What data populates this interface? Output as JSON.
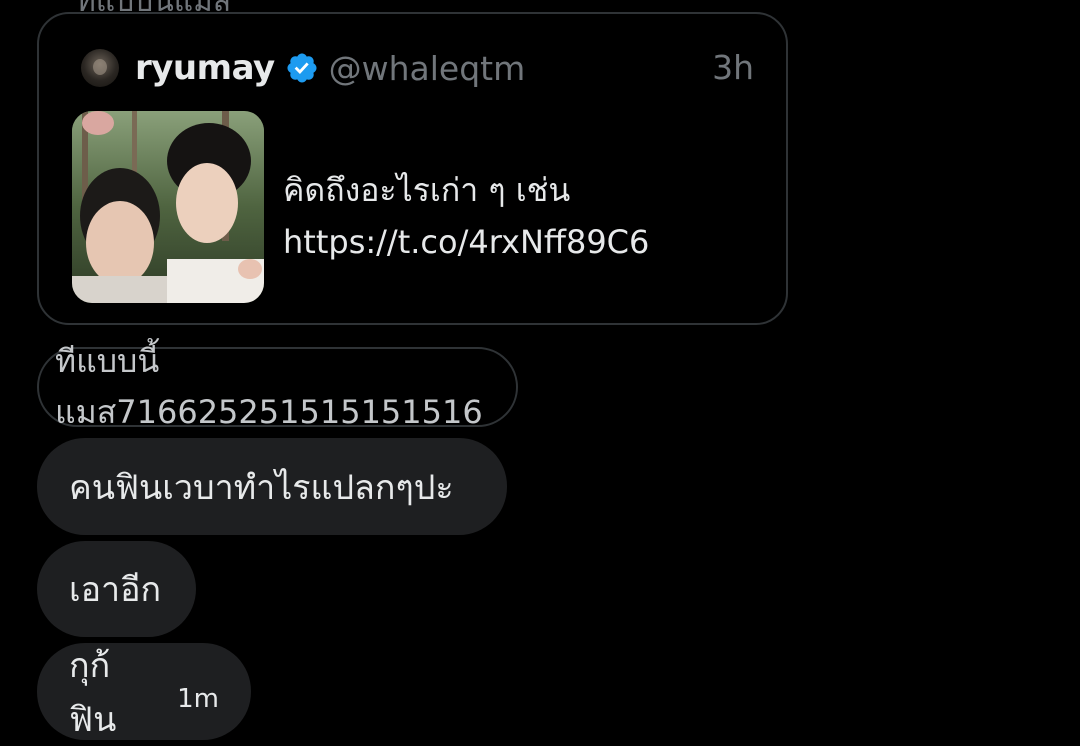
{
  "previous_message": {
    "text": "ทีแบบนี้แมส"
  },
  "quoted_tweet": {
    "name": "ryumay",
    "handle": "@whaleqtm",
    "time": "3h",
    "text_line1": "คิดถึงอะไรเก่า ๆ เช่น",
    "text_line2": "https://t.co/4rxNff89C6",
    "verified_color": "#1d9bf0"
  },
  "messages": [
    {
      "text": "ทีแบบนี้แมส716625251515151516"
    },
    {
      "text": "คนฟินเวบาทำไรแปลกๆปะ"
    },
    {
      "text": "เอาอีก"
    },
    {
      "text": "กุก้ฟิน",
      "time": "1m"
    }
  ]
}
